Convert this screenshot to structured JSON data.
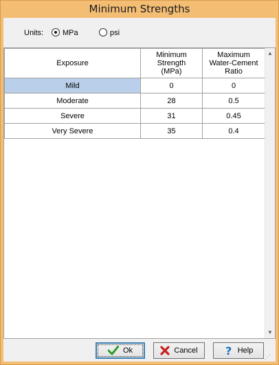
{
  "window": {
    "title": "Minimum Strengths"
  },
  "units": {
    "label": "Units:",
    "options": [
      {
        "label": "MPa",
        "selected": true
      },
      {
        "label": "psi",
        "selected": false
      }
    ]
  },
  "table": {
    "headers": [
      "Exposure",
      "Minimum\nStrength\n(MPa)",
      "Maximum\nWater-Cement\nRatio"
    ],
    "rows": [
      [
        "Mild",
        "0",
        "0"
      ],
      [
        "Moderate",
        "28",
        "0.5"
      ],
      [
        "Severe",
        "31",
        "0.45"
      ],
      [
        "Very Severe",
        "35",
        "0.4"
      ]
    ]
  },
  "buttons": {
    "ok": "Ok",
    "cancel": "Cancel",
    "help": "Help"
  },
  "colors": {
    "titlebar": "#f4bd74",
    "selection": "#b9cfea",
    "ok_icon": "#2e9a2e",
    "cancel_icon": "#c81e1e",
    "help_icon": "#1a6fc2"
  },
  "icons": {
    "ok": "checkmark-icon",
    "cancel": "red-x-icon",
    "help": "question-mark-icon"
  }
}
